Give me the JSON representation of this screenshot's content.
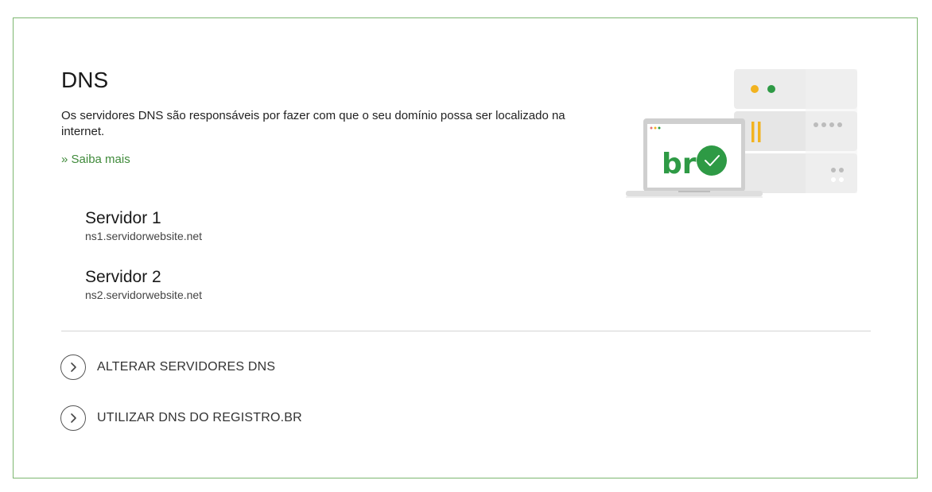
{
  "section": {
    "title": "DNS",
    "description": "Os servidores DNS são responsáveis por fazer com que o seu domínio possa ser localizado na internet.",
    "more_link": "» Saiba mais"
  },
  "servers": [
    {
      "name": "Servidor 1",
      "host": "ns1.servidorwebsite.net"
    },
    {
      "name": "Servidor 2",
      "host": "ns2.servidorwebsite.net"
    }
  ],
  "actions": [
    {
      "label": "ALTERAR SERVIDORES DNS",
      "icon": "chevron-right-icon"
    },
    {
      "label": "UTILIZAR DNS DO REGISTRO.BR",
      "icon": "chevron-right-icon"
    }
  ],
  "illustration": {
    "logo_text": "br",
    "icon": "check-icon"
  },
  "colors": {
    "border": "#7cb76f",
    "link": "#3f8a3a",
    "brand_green": "#2e9a45",
    "accent_yellow": "#f2b320"
  }
}
